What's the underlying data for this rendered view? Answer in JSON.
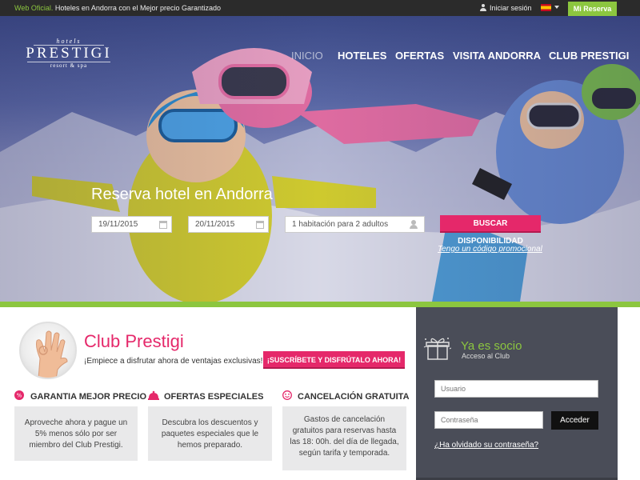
{
  "topbar": {
    "official_label": "Web Oficial.",
    "tagline": "Hoteles en Andorra con el Mejor precio Garantizado",
    "login_label": "Iniciar sesión",
    "reserva_label": "Mi Reserva"
  },
  "logo": {
    "top": "hotels",
    "name": "PRESTIGI",
    "sub": "resort & spa"
  },
  "nav": [
    "INICIO",
    "HOTELES",
    "OFERTAS",
    "VISITA ANDORRA",
    "CLUB PRESTIGI"
  ],
  "booking": {
    "title": "Reserva hotel en Andorra",
    "checkin": "19/11/2015",
    "checkout": "20/11/2015",
    "rooms": "1 habitación para 2 adultos",
    "search_label": "BUSCAR DISPONIBILIDAD",
    "promo_label": "Tengo un código promocional"
  },
  "club": {
    "title": "Club Prestigi",
    "subtitle": "¡Empiece a disfrutar ahora de ventajas exclusivas!",
    "cta_label": "¡SUSCRÍBETE Y DISFRÚTALO AHORA!"
  },
  "features": [
    {
      "title": "GARANTIA MEJOR PRECIO",
      "text": "Aproveche ahora y pague un 5% menos sólo por ser miembro del Club Prestigi."
    },
    {
      "title": "OFERTAS ESPECIALES",
      "text": "Descubra los descuentos y paquetes especiales que le hemos preparado."
    },
    {
      "title": "CANCELACIÓN GRATUITA",
      "text": "Gastos de cancelación gratuitos para reservas hasta las 18: 00h. del día de llegada, según tarifa y temporada."
    }
  ],
  "member": {
    "title": "Ya es socio",
    "subtitle": "Acceso al Club",
    "user_placeholder": "Usuario",
    "password_placeholder": "Contraseña",
    "submit_label": "Acceder",
    "forgot_label": "¿Ha olvidado su contraseña?"
  },
  "colors": {
    "accent_pink": "#e5286a",
    "accent_green": "#8cc63f",
    "panel_dark": "#4a4d58"
  }
}
